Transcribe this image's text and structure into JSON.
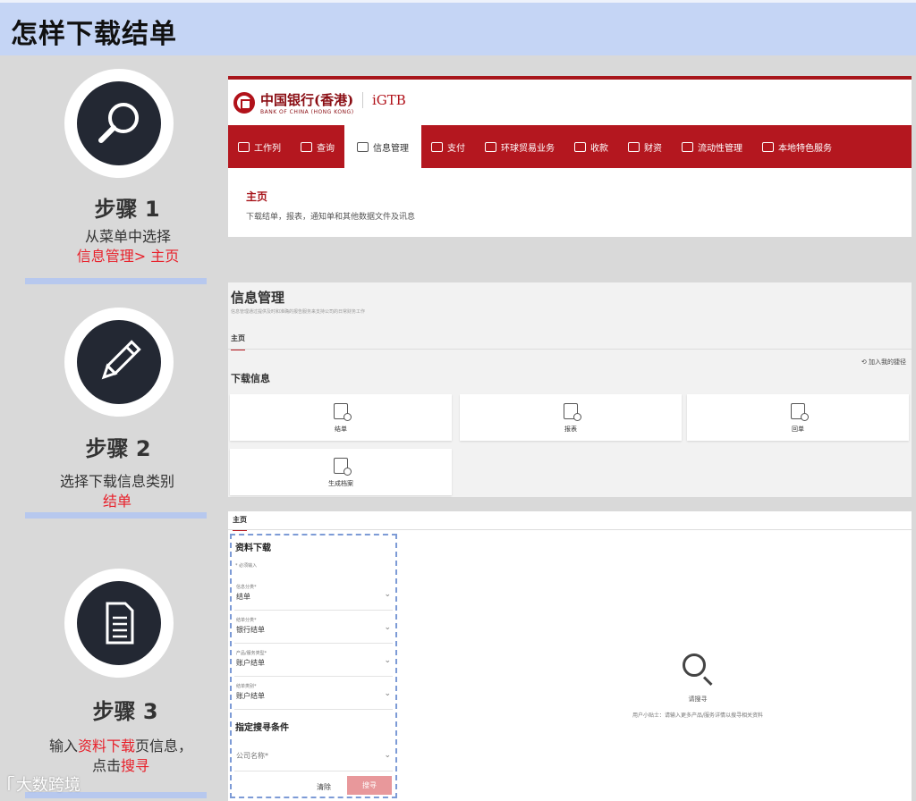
{
  "header": {
    "title": "怎样下载结单"
  },
  "steps": [
    {
      "title": "步骤 1",
      "desc_line1": "从菜单中选择",
      "desc_highlight": "信息管理> 主页",
      "icon": "magnifier-icon"
    },
    {
      "title": "步骤 2",
      "desc_line1": "选择下载信息类别",
      "desc_highlight": "结单",
      "icon": "pencil-icon"
    },
    {
      "title": "步骤 3",
      "desc_prefix": "输入",
      "desc_highlight1": "资料下载",
      "desc_mid": "页信息，",
      "desc_line2_prefix": "点击",
      "desc_highlight2": "搜寻",
      "icon": "document-icon"
    }
  ],
  "panel1": {
    "logo_cn": "中国银行(香港)",
    "logo_en": "BANK OF CHINA (HONG KONG)",
    "product": "iGTB",
    "nav": [
      "工作列",
      "查询",
      "信息管理",
      "支付",
      "环球贸易业务",
      "收款",
      "财资",
      "流动性管理",
      "本地特色服务"
    ],
    "active_nav": "信息管理",
    "home_title": "主页",
    "home_desc": "下载结单，报表，通知单和其他数据文件及讯息"
  },
  "panel2": {
    "title": "信息管理",
    "subtitle": "信息管理通过提供及时和准确的报告服务来支持公司的日常财务工作",
    "tab": "主页",
    "favorite": "加入我的捷径",
    "section": "下载信息",
    "cards": [
      "结单",
      "报表",
      "回单",
      "生成档案"
    ]
  },
  "panel3": {
    "tab": "主页",
    "form_title": "资料下载",
    "required_note": "* 必须输入",
    "fields": [
      {
        "label": "信息分类*",
        "value": "结单"
      },
      {
        "label": "结单分类*",
        "value": "银行结单"
      },
      {
        "label": "产品/服务类型*",
        "value": "账户结单"
      },
      {
        "label": "结单类别*",
        "value": "账户结单"
      }
    ],
    "criteria_title": "指定搜寻条件",
    "company_field": "公司名称*",
    "clear_label": "清除",
    "search_label": "搜寻",
    "search_prompt": "请搜寻",
    "search_tip": "用户小贴士：请输入更多产品/服务详情以搜寻相关资料"
  },
  "watermark": "大数跨境",
  "colors": {
    "header_bg": "#c5d5f5",
    "brand_red": "#b4171f",
    "highlight_red": "#e8202a",
    "separator": "#b7c8ee"
  }
}
